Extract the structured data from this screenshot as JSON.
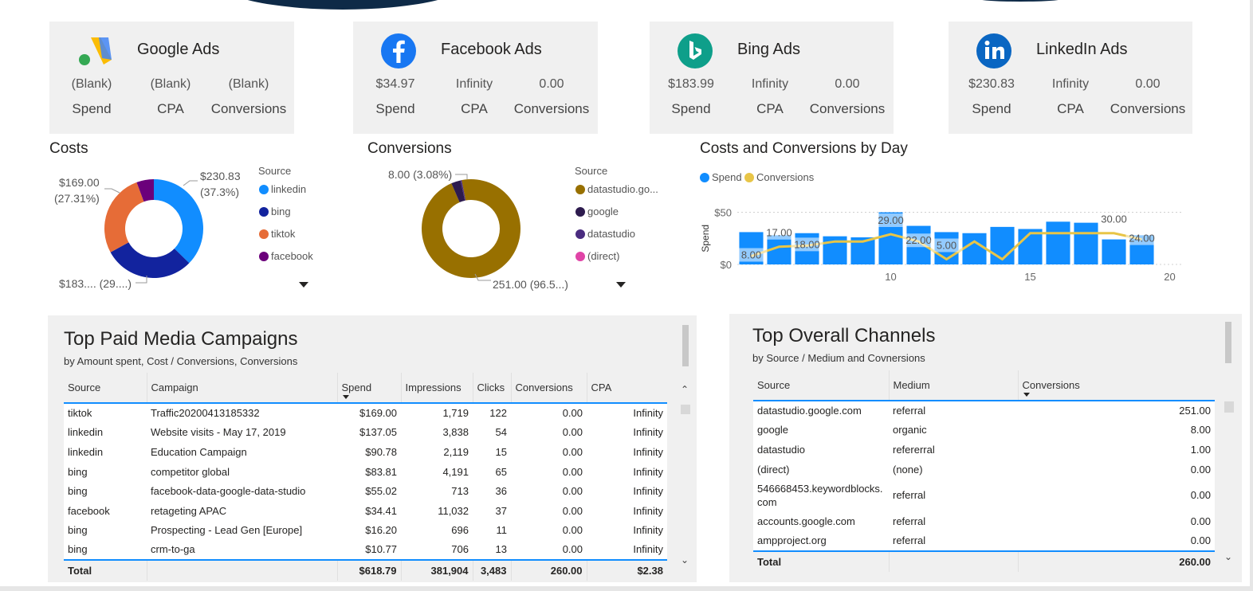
{
  "cards": [
    {
      "title": "Google Ads",
      "spend": "(Blank)",
      "cpa": "(Blank)",
      "conversions": "(Blank)",
      "spend_label": "Spend",
      "cpa_label": "CPA",
      "conv_label": "Conversions"
    },
    {
      "title": "Facebook Ads",
      "spend": "$34.97",
      "cpa": "Infinity",
      "conversions": "0.00",
      "spend_label": "Spend",
      "cpa_label": "CPA",
      "conv_label": "Conversions"
    },
    {
      "title": "Bing Ads",
      "spend": "$183.99",
      "cpa": "Infinity",
      "conversions": "0.00",
      "spend_label": "Spend",
      "cpa_label": "CPA",
      "conv_label": "Conversions"
    },
    {
      "title": "LinkedIn Ads",
      "spend": "$230.83",
      "cpa": "Infinity",
      "conversions": "0.00",
      "spend_label": "Spend",
      "cpa_label": "CPA",
      "conv_label": "Conversions"
    }
  ],
  "colors": {
    "blue": "#118dff",
    "navy": "#12239e",
    "orange": "#e66c37",
    "purple": "#6b007b",
    "gold": "#987000",
    "dark": "#2d1b4e",
    "violet": "#4a2c7f",
    "pink": "#e044a7",
    "line": "#e8c547",
    "panel": "#f0f0f0"
  },
  "chart_data": [
    {
      "type": "pie",
      "title": "Costs",
      "legend_title": "Source",
      "labels": [
        "linkedin",
        "bing",
        "tiktok",
        "facebook"
      ],
      "values": [
        230.83,
        183.99,
        169.0,
        34.97
      ],
      "data_labels": {
        "linkedin": [
          "$230.83",
          "(37.3%)"
        ],
        "tiktok": [
          "$169.00",
          "(27.31%)"
        ],
        "bing": [
          "$183.... (29....)"
        ]
      }
    },
    {
      "type": "pie",
      "title": "Conversions",
      "legend_title": "Source",
      "labels": [
        "datastudio.go...",
        "google",
        "datastudio",
        "(direct)"
      ],
      "values": [
        251.0,
        8.0,
        1.0,
        0.0
      ],
      "data_labels": {
        "google": [
          "8.00 (3.08%)"
        ],
        "datastudio.go...": [
          "251.00 (96.5...)"
        ]
      }
    },
    {
      "type": "bar",
      "title": "Costs and Conversions by Day",
      "legend": [
        "Spend",
        "Conversions"
      ],
      "ylabel": "Spend",
      "yticks": [
        "$0",
        "$50"
      ],
      "xticks": [
        "10",
        "15",
        "20"
      ],
      "x": [
        5,
        6,
        7,
        8,
        9,
        10,
        11,
        12,
        13,
        14,
        15,
        16,
        17,
        18,
        19
      ],
      "series": [
        {
          "name": "Spend",
          "type": "bar",
          "values": [
            31,
            28,
            30,
            27,
            26,
            50,
            37,
            31,
            30,
            36,
            34,
            41,
            40,
            24,
            28
          ]
        },
        {
          "name": "Conversions",
          "type": "line",
          "values": [
            8,
            17,
            18,
            22,
            22,
            29,
            22,
            5,
            22,
            5,
            30,
            30,
            30,
            30,
            24
          ],
          "data_labels": [
            "8.00",
            "17.00",
            "18.00",
            "",
            "",
            "29.00",
            "22.00",
            "5.00",
            "",
            "",
            "",
            "",
            "",
            "30.00",
            "24.00"
          ]
        }
      ],
      "ylim": [
        0,
        55
      ]
    }
  ],
  "campaigns": {
    "title": "Top Paid Media Campaigns",
    "subtitle": "by Amount spent, Cost / Conversions, Conversions",
    "columns": [
      "Source",
      "Campaign",
      "Spend",
      "Impressions",
      "Clicks",
      "Conversions",
      "CPA"
    ],
    "rows": [
      [
        "tiktok",
        "Traffic20200413185332",
        "$169.00",
        "1,719",
        "122",
        "0.00",
        "Infinity"
      ],
      [
        "linkedin",
        "Website visits - May 17, 2019",
        "$137.05",
        "3,838",
        "54",
        "0.00",
        "Infinity"
      ],
      [
        "linkedin",
        "Education Campaign",
        "$90.78",
        "2,119",
        "15",
        "0.00",
        "Infinity"
      ],
      [
        "bing",
        "competitor global",
        "$83.81",
        "4,191",
        "65",
        "0.00",
        "Infinity"
      ],
      [
        "bing",
        "facebook-data-google-data-studio",
        "$55.02",
        "713",
        "36",
        "0.00",
        "Infinity"
      ],
      [
        "facebook",
        "retageting APAC",
        "$34.41",
        "11,032",
        "37",
        "0.00",
        "Infinity"
      ],
      [
        "bing",
        "Prospecting - Lead Gen [Europe]",
        "$16.20",
        "696",
        "11",
        "0.00",
        "Infinity"
      ],
      [
        "bing",
        "crm-to-ga",
        "$10.77",
        "706",
        "13",
        "0.00",
        "Infinity"
      ]
    ],
    "total": [
      "Total",
      "",
      "$618.79",
      "381,904",
      "3,483",
      "260.00",
      "$2.38"
    ]
  },
  "channels": {
    "title": "Top Overall Channels",
    "subtitle": "by Source / Medium and Covnersions",
    "columns": [
      "Source",
      "Medium",
      "Conversions"
    ],
    "rows": [
      [
        "datastudio.google.com",
        "referral",
        "251.00"
      ],
      [
        "google",
        "organic",
        "8.00"
      ],
      [
        "datastudio",
        "refererral",
        "1.00"
      ],
      [
        "(direct)",
        "(none)",
        "0.00"
      ],
      [
        "546668453.keywordblocks.\ncom",
        "referral",
        "0.00"
      ],
      [
        "accounts.google.com",
        "referral",
        "0.00"
      ],
      [
        "ampproject.org",
        "referral",
        "0.00"
      ]
    ],
    "total": [
      "Total",
      "",
      "260.00"
    ]
  }
}
